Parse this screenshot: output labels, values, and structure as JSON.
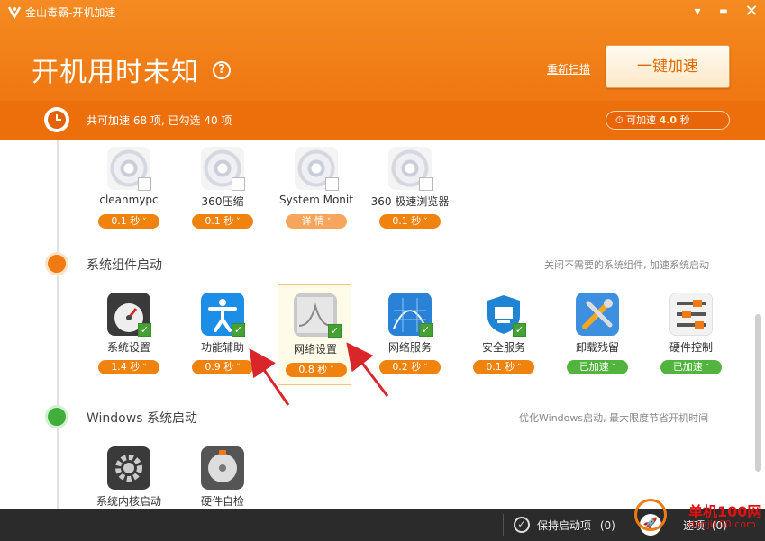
{
  "window": {
    "title": "金山毒霸-开机加速",
    "menu_glyph": "▾",
    "min_glyph": "▬",
    "close_glyph": "✕"
  },
  "header": {
    "big_title": "开机用时未知",
    "help_glyph": "?",
    "rescan_label": "重新扫描",
    "accelerate_label": "一键加速",
    "summary": "共可加速 68 项, 已勾选 40 项",
    "speed_prefix": "可加速",
    "speed_value": "4.0",
    "speed_unit": "秒"
  },
  "top_items": [
    {
      "name": "cleanmypc",
      "time": "0.1 秒",
      "checked": false,
      "style": "normal"
    },
    {
      "name": "360压缩",
      "time": "0.1 秒",
      "checked": false,
      "style": "normal"
    },
    {
      "name": "System Monit",
      "time": "详 情",
      "checked": false,
      "style": "light"
    },
    {
      "name": "360 极速浏览器",
      "time": "0.1 秒",
      "checked": false,
      "style": "normal"
    }
  ],
  "sections": {
    "system": {
      "title": "系统组件启动",
      "hint": "关闭不需要的系统组件, 加速系统启动",
      "items": [
        {
          "name": "系统设置",
          "time": "1.4 秒",
          "checked": true,
          "style": "normal",
          "icon": "gauge-icon"
        },
        {
          "name": "功能辅助",
          "time": "0.9 秒",
          "checked": true,
          "style": "normal",
          "icon": "accessibility-icon"
        },
        {
          "name": "网络设置",
          "time": "0.8 秒",
          "checked": true,
          "style": "normal",
          "icon": "network-chart-icon"
        },
        {
          "name": "网络服务",
          "time": "0.2 秒",
          "checked": true,
          "style": "normal",
          "icon": "network-service-icon"
        },
        {
          "name": "安全服务",
          "time": "0.1 秒",
          "checked": true,
          "style": "normal",
          "icon": "shield-icon"
        },
        {
          "name": "卸载残留",
          "time": "已加速",
          "checked": false,
          "style": "green",
          "icon": "tools-icon"
        },
        {
          "name": "硬件控制",
          "time": "已加速",
          "checked": false,
          "style": "green",
          "icon": "sliders-icon"
        }
      ]
    },
    "windows": {
      "title": "Windows 系统启动",
      "hint": "优化Windows启动, 最大限度节省开机时间",
      "items": [
        {
          "name": "系统内核启动",
          "icon": "gear-icon"
        },
        {
          "name": "硬件自检",
          "icon": "hard-disk-icon"
        }
      ]
    }
  },
  "footer": {
    "keep_label": "保持启动项",
    "keep_count": "(0)",
    "boosted_label": "速项",
    "boosted_count": "(0)"
  },
  "watermark": {
    "line1": "单机100网",
    "line2": "danji100.com"
  },
  "colors": {
    "brand_orange": "#f07a14",
    "pill_orange": "#f0820e",
    "accelerated_green": "#52b43e",
    "footer_bg": "#2b2b2b"
  }
}
